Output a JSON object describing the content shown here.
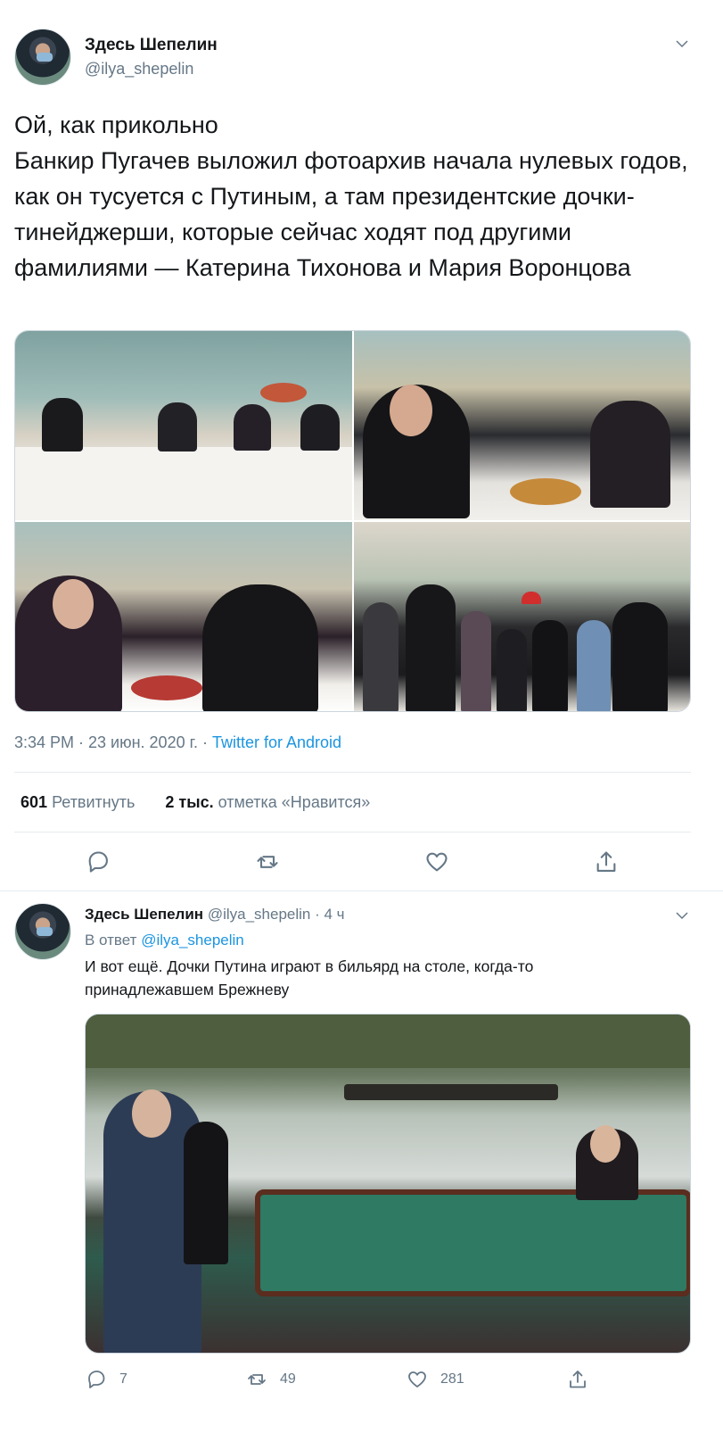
{
  "main_tweet": {
    "author_name": "Здесь Шепелин",
    "author_handle": "@ilya_shepelin",
    "text": "Ой, как прикольно\nБанкир Пугачев выложил фотоархив начала нулевых годов, как он тусуется с Путиным, а там президентские дочки-тинейджерши, которые сейчас ходят под другими фамилиями — Катерина Тихонова и Мария Воронцова",
    "timestamp": "3:34 PM · 23 июн. 2020 г. · ",
    "source": "Twitter for Android",
    "retweets_count": "601",
    "retweets_label": "Ретвитнуть",
    "likes_count": "2 тыс.",
    "likes_label": "отметка «Нравится»",
    "icons": [
      "reply-icon",
      "retweet-icon",
      "like-icon",
      "share-icon"
    ]
  },
  "reply_tweet": {
    "author_name": "Здесь Шепелин",
    "author_handle": "@ilya_shepelin",
    "time": "· 4 ч",
    "in_reply_prefix": "В ответ",
    "in_reply_mention": "@ilya_shepelin",
    "text": "И вот ещё. Дочки Путина играют в бильярд на столе, когда-то принадлежавшем Брежневу",
    "reply_count": "7",
    "retweet_count": "49",
    "like_count": "281"
  },
  "colors": {
    "accent": "#1b95e0",
    "secondary_text": "#657786",
    "divider": "#e6ecf0"
  }
}
